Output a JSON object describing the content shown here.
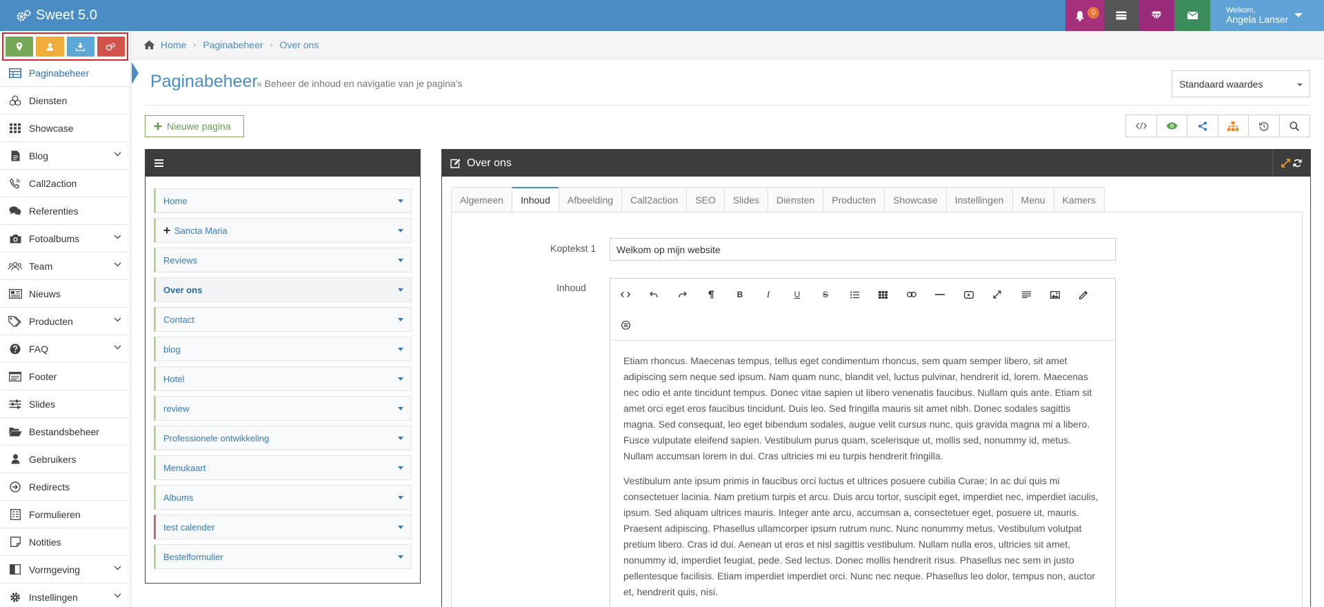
{
  "app": {
    "title": "Sweet 5.0"
  },
  "topbar": {
    "notification_count": "0",
    "welcome": "Welkom,",
    "user_name": "Angela Lanser"
  },
  "sidebar": {
    "items": [
      {
        "label": "Paginabeheer",
        "icon": "table-icon",
        "active": true
      },
      {
        "label": "Diensten",
        "icon": "cubes-icon"
      },
      {
        "label": "Showcase",
        "icon": "grid-icon"
      },
      {
        "label": "Blog",
        "icon": "file-icon",
        "expandable": true
      },
      {
        "label": "Call2action",
        "icon": "phone-icon"
      },
      {
        "label": "Referenties",
        "icon": "comments-icon"
      },
      {
        "label": "Fotoalbums",
        "icon": "camera-icon",
        "expandable": true
      },
      {
        "label": "Team",
        "icon": "users-icon",
        "expandable": true
      },
      {
        "label": "Nieuws",
        "icon": "newspaper-icon"
      },
      {
        "label": "Producten",
        "icon": "tags-icon",
        "expandable": true
      },
      {
        "label": "FAQ",
        "icon": "question-icon",
        "expandable": true
      },
      {
        "label": "Footer",
        "icon": "list-alt-icon"
      },
      {
        "label": "Slides",
        "icon": "sliders-icon"
      },
      {
        "label": "Bestandsbeheer",
        "icon": "folder-open-icon"
      },
      {
        "label": "Gebruikers",
        "icon": "user-icon"
      },
      {
        "label": "Redirects",
        "icon": "arrow-circle-icon"
      },
      {
        "label": "Formulieren",
        "icon": "form-icon"
      },
      {
        "label": "Notities",
        "icon": "note-icon"
      },
      {
        "label": "Vormgeving",
        "icon": "columns-icon",
        "expandable": true
      },
      {
        "label": "Instellingen",
        "icon": "gear-icon",
        "expandable": true
      }
    ]
  },
  "breadcrumb": {
    "items": [
      "Home",
      "Paginabeheer",
      "Over ons"
    ]
  },
  "page": {
    "title": "Paginabeheer",
    "subtitle": "» Beheer de inhoud en navigatie van je pagina's",
    "select_value": "Standaard waardes",
    "new_page_label": "Nieuwe pagina"
  },
  "tree": {
    "items": [
      {
        "label": "Home"
      },
      {
        "label": "Sancta Maria",
        "plus": true
      },
      {
        "label": "Reviews"
      },
      {
        "label": "Over ons",
        "selected": true
      },
      {
        "label": "Contact"
      },
      {
        "label": "blog"
      },
      {
        "label": "Hotel"
      },
      {
        "label": "review"
      },
      {
        "label": "Professionele ontwikkeling"
      },
      {
        "label": "Menukaart"
      },
      {
        "label": "Albums"
      },
      {
        "label": "test calender",
        "red": true
      },
      {
        "label": "Bestelformulier"
      }
    ]
  },
  "editor_panel": {
    "title": "Over ons",
    "tabs": [
      "Algemeen",
      "Inhoud",
      "Afbeelding",
      "Call2action",
      "SEO",
      "Slides",
      "Diensten",
      "Producten",
      "Showcase",
      "Instellingen",
      "Menu",
      "Kamers"
    ],
    "active_tab": "Inhoud",
    "koptekst_label": "Koptekst 1",
    "koptekst_value": "Welkom op mijn website",
    "inhoud_label": "Inhoud",
    "paragraphs": [
      "Etiam rhoncus. Maecenas tempus, tellus eget condimentum rhoncus, sem quam semper libero, sit amet adipiscing sem neque sed ipsum. Nam quam nunc, blandit vel, luctus pulvinar, hendrerit id, lorem. Maecenas nec odio et ante tincidunt tempus. Donec vitae sapien ut libero venenatis faucibus. Nullam quis ante. Etiam sit amet orci eget eros faucibus tincidunt. Duis leo. Sed fringilla mauris sit amet nibh. Donec sodales sagittis magna. Sed consequat, leo eget bibendum sodales, augue velit cursus nunc, quis gravida magna mi a libero. Fusce vulputate eleifend sapien. Vestibulum purus quam, scelerisque ut, mollis sed, nonummy id, metus. Nullam accumsan lorem in dui. Cras ultricies mi eu turpis hendrerit fringilla.",
      "Vestibulum ante ipsum primis in faucibus orci luctus et ultrices posuere cubilia Curae; In ac dui quis mi consectetuer lacinia. Nam pretium turpis et arcu. Duis arcu tortor, suscipit eget, imperdiet nec, imperdiet iaculis, ipsum. Sed aliquam ultrices mauris. Integer ante arcu, accumsan a, consectetuer eget, posuere ut, mauris. Praesent adipiscing. Phasellus ullamcorper ipsum rutrum nunc. Nunc nonummy metus. Vestibulum volutpat pretium libero. Cras id dui. Aenean ut eros et nisl sagittis vestibulum. Nullam nulla eros, ultricies sit amet, nonummy id, imperdiet feugiat, pede. Sed lectus. Donec mollis hendrerit risus. Phasellus nec sem in justo pellentesque facilisis. Etiam imperdiet imperdiet orci. Nunc nec neque. Phasellus leo dolor, tempus non, auctor et, hendrerit quis, nisi."
    ]
  }
}
